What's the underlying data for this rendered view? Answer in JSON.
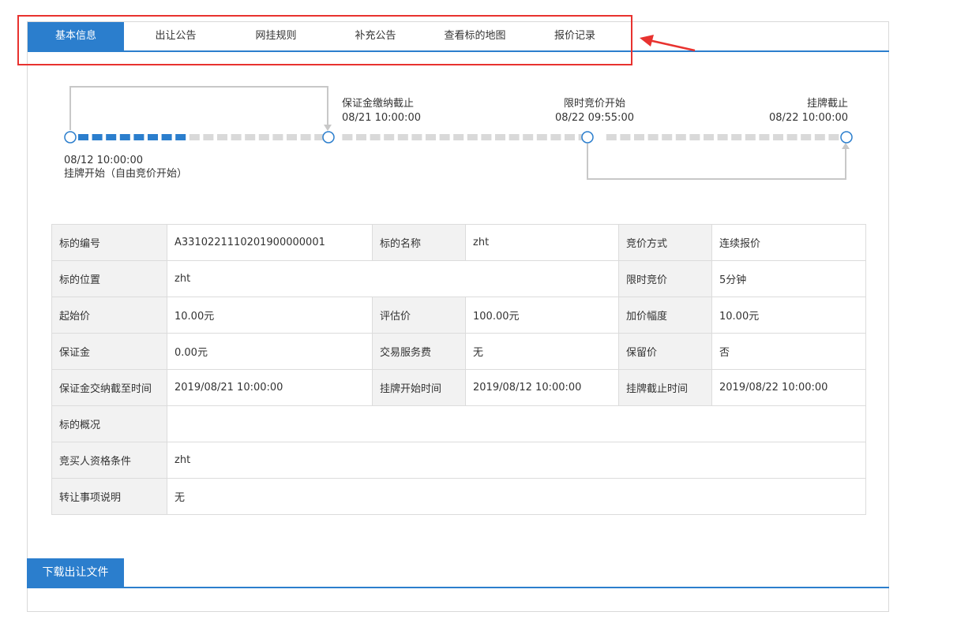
{
  "tabs": [
    {
      "label": "基本信息",
      "active": true
    },
    {
      "label": "出让公告",
      "active": false
    },
    {
      "label": "网挂规则",
      "active": false
    },
    {
      "label": "补充公告",
      "active": false
    },
    {
      "label": "查看标的地图",
      "active": false
    },
    {
      "label": "报价记录",
      "active": false
    }
  ],
  "annotation": {
    "box_color": "#e8322f",
    "arrow_color": "#e8322f"
  },
  "timeline": {
    "progress": 0.48,
    "start": {
      "time": "08/12 10:00:00",
      "label": "挂牌开始（自由竞价开始）"
    },
    "deposit_deadline": {
      "label": "保证金缴纳截止",
      "time": "08/21 10:00:00"
    },
    "timed_bidding_start": {
      "label": "限时竞价开始",
      "time": "08/22 09:55:00"
    },
    "listing_end": {
      "label": "挂牌截止",
      "time": "08/22 10:00:00"
    },
    "colors": {
      "active": "#2b7ecd",
      "inactive": "#d9d9d9",
      "connector": "#c8c8c8"
    }
  },
  "info_table": {
    "rows": [
      [
        {
          "label": "标的编号",
          "value": "A3310221110201900000001"
        },
        {
          "label": "标的名称",
          "value": "zht"
        },
        {
          "label": "竞价方式",
          "value": "连续报价"
        }
      ],
      [
        {
          "label": "标的位置",
          "value": "zht"
        },
        {
          "label": "限时竞价",
          "value": "5分钟"
        }
      ],
      [
        {
          "label": "起始价",
          "value": "10.00元"
        },
        {
          "label": "评估价",
          "value": "100.00元"
        },
        {
          "label": "加价幅度",
          "value": "10.00元"
        }
      ],
      [
        {
          "label": "保证金",
          "value": "0.00元"
        },
        {
          "label": "交易服务费",
          "value": "无"
        },
        {
          "label": "保留价",
          "value": "否"
        }
      ],
      [
        {
          "label": "保证金交纳截至时间",
          "value": "2019/08/21 10:00:00"
        },
        {
          "label": "挂牌开始时间",
          "value": "2019/08/12 10:00:00"
        },
        {
          "label": "挂牌截止时间",
          "value": "2019/08/22 10:00:00"
        }
      ],
      [
        {
          "label": "标的概况",
          "value": ""
        }
      ],
      [
        {
          "label": "竞买人资格条件",
          "value": "zht"
        }
      ],
      [
        {
          "label": "转让事项说明",
          "value": "无"
        }
      ]
    ]
  },
  "download": {
    "label": "下载出让文件"
  },
  "theme": {
    "primary": "#2b7ecd",
    "label_bg": "#f2f2f2",
    "border": "#dcdcdc"
  }
}
